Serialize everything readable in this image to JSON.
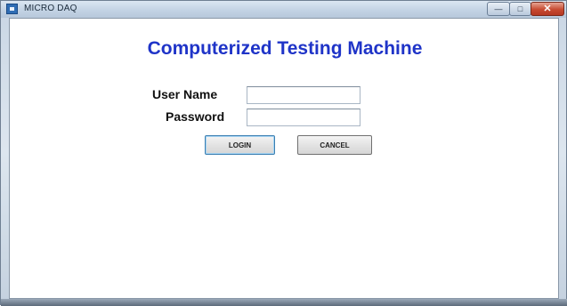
{
  "window": {
    "title": "MICRO DAQ",
    "min_symbol": "—",
    "max_symbol": "□",
    "close_symbol": "✕"
  },
  "form": {
    "heading": "Computerized Testing Machine",
    "username_label": "User Name",
    "username_value": "",
    "password_label": "Password",
    "password_value": "",
    "login_label": "LOGIN",
    "cancel_label": "CANCEL"
  },
  "colors": {
    "heading": "#1f34c8",
    "close_button": "#c74a31"
  }
}
